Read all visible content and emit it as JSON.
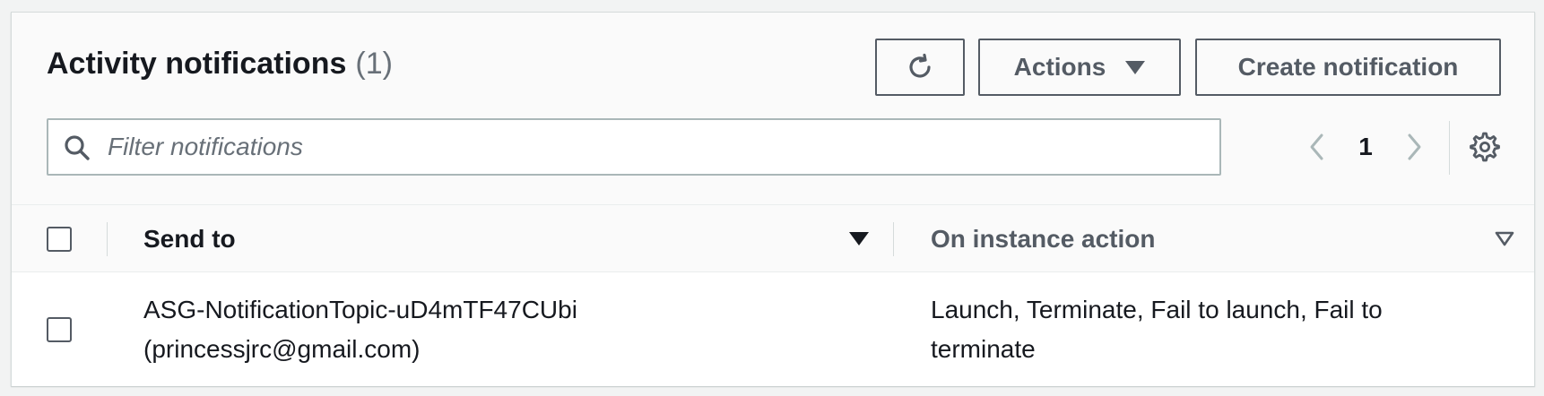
{
  "header": {
    "title": "Activity notifications",
    "count": "(1)"
  },
  "toolbar": {
    "refresh_icon": "refresh-icon",
    "actions_label": "Actions",
    "create_label": "Create notification"
  },
  "filter": {
    "placeholder": "Filter notifications",
    "value": ""
  },
  "pagination": {
    "current_page": "1"
  },
  "table": {
    "columns": [
      {
        "label": "Send to",
        "sort": "descending"
      },
      {
        "label": "On instance action",
        "sort": "none"
      }
    ],
    "rows": [
      {
        "selected": false,
        "send_to_topic": "ASG-NotificationTopic-uD4mTF47CUbi",
        "send_to_email": "(princessjrc@gmail.com)",
        "on_instance_action_line1": "Launch, Terminate, Fail to launch, Fail to",
        "on_instance_action_line2": "terminate"
      }
    ]
  },
  "colors": {
    "text_primary": "#16191f",
    "text_secondary": "#545b64",
    "muted": "#687078",
    "border": "#aab7b8",
    "background": "#f2f3f3"
  }
}
